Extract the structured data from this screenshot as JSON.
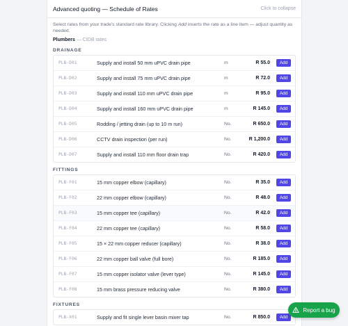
{
  "header": {
    "title": "Advanced quoting — Schedule of Rates",
    "collapse_label": "Click to collapse"
  },
  "intro": {
    "before": "Select rates from your trade's standard rate library. Clicking ",
    "em": "Add",
    "after": " inserts the rate as a line item — adjust quantity as needed."
  },
  "trade": {
    "name": "Plumbers",
    "separator": " — ",
    "library": "CIDB rates"
  },
  "add_label": "Add",
  "sections": [
    {
      "title": "DRAINAGE",
      "rows": [
        {
          "code": "PLB-D01",
          "desc": "Supply and install 50 mm uPVC drain pipe",
          "unit": "m",
          "price": "R 55.0"
        },
        {
          "code": "PLB-D02",
          "desc": "Supply and install 75 mm uPVC drain pipe",
          "unit": "m",
          "price": "R 72.0"
        },
        {
          "code": "PLB-D03",
          "desc": "Supply and install 110 mm uPVC drain pipe",
          "unit": "m",
          "price": "R 95.0"
        },
        {
          "code": "PLB-D04",
          "desc": "Supply and install 160 mm uPVC drain pipe",
          "unit": "m",
          "price": "R 145.0"
        },
        {
          "code": "PLB-D05",
          "desc": "Rodding / jetting drain (up to 10 m run)",
          "unit": "No.",
          "price": "R 650.0"
        },
        {
          "code": "PLB-D06",
          "desc": "CCTV drain inspection (per run)",
          "unit": "No.",
          "price": "R 1,200.0"
        },
        {
          "code": "PLB-D07",
          "desc": "Supply and install 110 mm floor drain trap",
          "unit": "No.",
          "price": "R 420.0"
        }
      ]
    },
    {
      "title": "FITTINGS",
      "rows": [
        {
          "code": "PLB-F01",
          "desc": "15 mm copper elbow (capillary)",
          "unit": "No.",
          "price": "R 35.0"
        },
        {
          "code": "PLB-F02",
          "desc": "22 mm copper elbow (capillary)",
          "unit": "No.",
          "price": "R 48.0"
        },
        {
          "code": "PLB-F03",
          "desc": "15 mm copper tee (capillary)",
          "unit": "No.",
          "price": "R 42.0"
        },
        {
          "code": "PLB-F04",
          "desc": "22 mm copper tee (capillary)",
          "unit": "No.",
          "price": "R 58.0"
        },
        {
          "code": "PLB-F05",
          "desc": "15 × 22 mm copper reducer (capillary)",
          "unit": "No.",
          "price": "R 38.0"
        },
        {
          "code": "PLB-F06",
          "desc": "22 mm copper ball valve (full bore)",
          "unit": "No.",
          "price": "R 185.0"
        },
        {
          "code": "PLB-F07",
          "desc": "15 mm copper isolator valve (lever type)",
          "unit": "No.",
          "price": "R 145.0"
        },
        {
          "code": "PLB-F08",
          "desc": "15 mm brass pressure reducing valve",
          "unit": "No.",
          "price": "R 380.0"
        }
      ]
    },
    {
      "title": "FIXTURES",
      "rows": [
        {
          "code": "PLB-X01",
          "desc": "Supply and fit single lever basin mixer tap",
          "unit": "No.",
          "price": "R 850.0"
        }
      ]
    }
  ],
  "report_bug": {
    "label": "Report a bug",
    "icon": "warning-triangle-icon",
    "color": "#16a34a"
  },
  "colors": {
    "accent": "#4f46e5"
  }
}
